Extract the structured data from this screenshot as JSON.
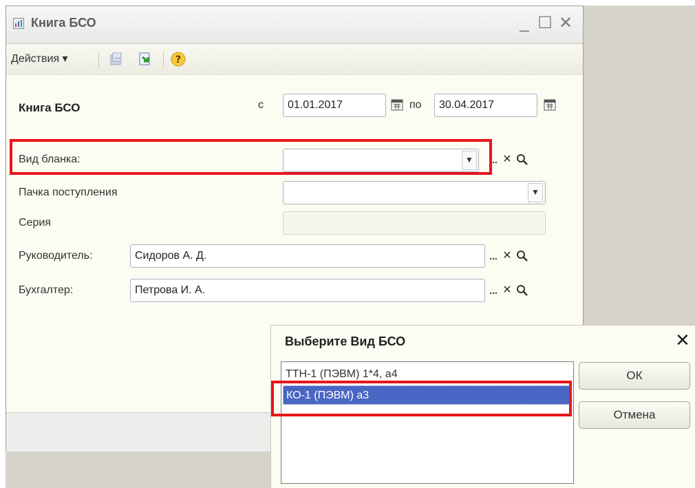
{
  "window": {
    "title": "Книга БСО",
    "minimize": "_",
    "maximize": "☐",
    "close": "✕"
  },
  "toolbar": {
    "actions_label": "Действия ▾",
    "help": "?"
  },
  "form": {
    "heading": "Книга БСО",
    "from_label": "с",
    "from_date": "01.01.2017",
    "to_label": "по",
    "to_date": "30.04.2017",
    "blank_type_label": "Вид бланка:",
    "blank_type_value": "",
    "pack_label": "Пачка поступления",
    "pack_value": "",
    "series_label": "Серия",
    "series_value": "",
    "head_label": "Руководитель:",
    "head_value": "Сидоров А. Д.",
    "accountant_label": "Бухгалтер:",
    "accountant_value": "Петрова И. А."
  },
  "controls": {
    "ellipsis": "...",
    "clear": "✕",
    "dropdown": "▼"
  },
  "dialog": {
    "title": "Выберите Вид БСО",
    "close": "✕",
    "items": [
      "ТТН-1 (ПЭВМ) 1*4, а4",
      "КО-1 (ПЭВМ)  а3"
    ],
    "selected_index": 1,
    "ok_label": "ОК",
    "cancel_label": "Отмена"
  },
  "colors": {
    "highlight": "#e8151b",
    "selection": "#4a66c4"
  }
}
